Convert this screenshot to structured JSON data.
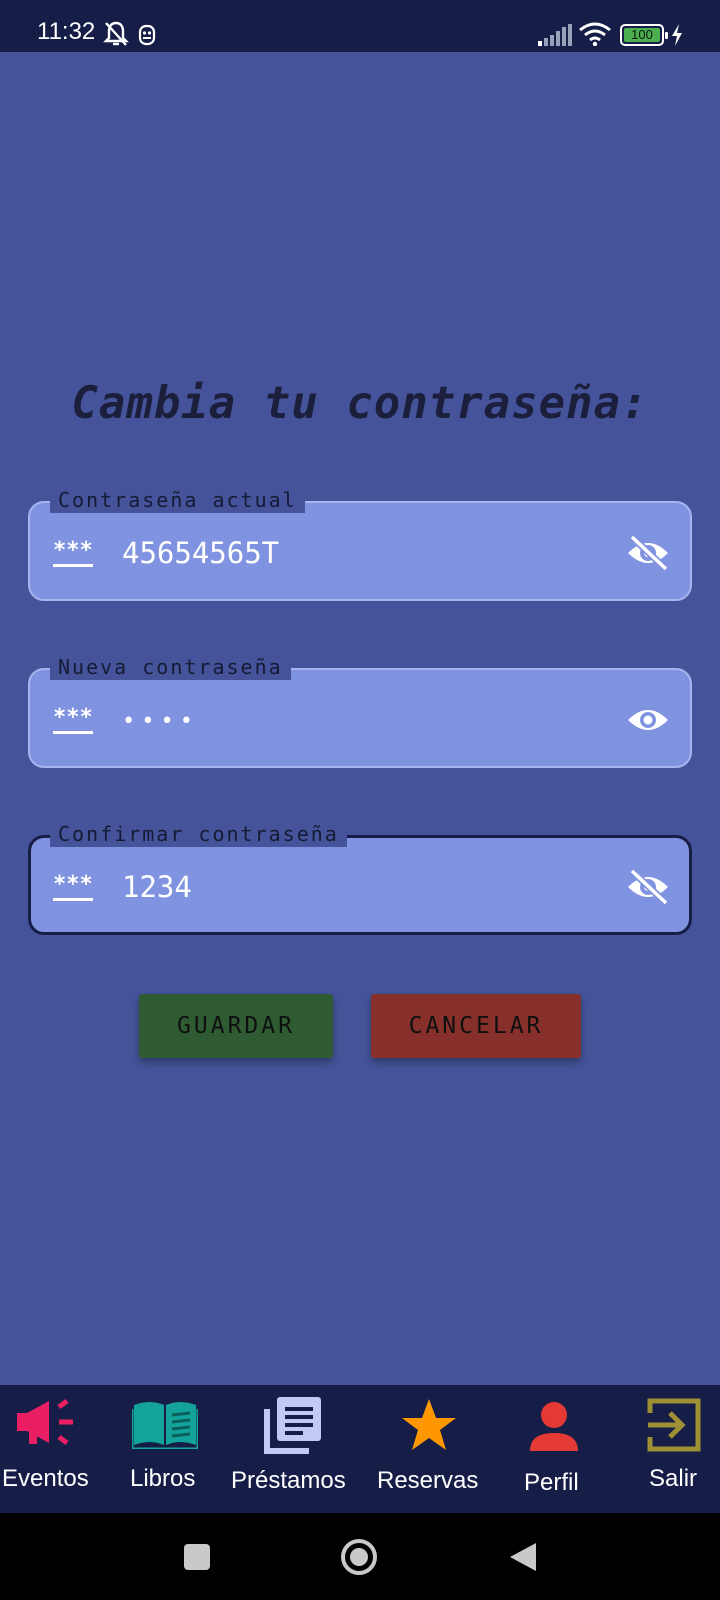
{
  "status_bar": {
    "time": "11:32",
    "battery": "100",
    "icons": [
      "bell-off-icon",
      "mask-icon",
      "signal-icon",
      "wifi-icon",
      "battery-icon",
      "charging-icon"
    ]
  },
  "page": {
    "title": "Cambia tu contraseña:",
    "background": "#45549a"
  },
  "form": {
    "current_password": {
      "label": "Contraseña actual",
      "value": "45654565T",
      "visibility_icon": "eye-off-icon"
    },
    "new_password": {
      "label": "Nueva contraseña",
      "masked_value": "••••",
      "visibility_icon": "eye-icon"
    },
    "confirm_password": {
      "label": "Confirmar contraseña",
      "value": "1234",
      "visibility_icon": "eye-off-icon"
    }
  },
  "buttons": {
    "save": {
      "label": "GUARDAR",
      "color": "#2f5b33"
    },
    "cancel": {
      "label": "CANCELAR",
      "color": "#87302b"
    }
  },
  "bottom_nav": {
    "items": [
      {
        "label": "Eventos",
        "icon": "megaphone-icon",
        "color": "#e91e63"
      },
      {
        "label": "Libros",
        "icon": "book-icon",
        "color": "#14a39a"
      },
      {
        "label": "Préstamos",
        "icon": "library-icon",
        "color": "#c3c9f5"
      },
      {
        "label": "Reservas",
        "icon": "star-icon",
        "color": "#ff9800"
      },
      {
        "label": "Perfil",
        "icon": "person-icon",
        "color": "#e53935"
      },
      {
        "label": "Salir",
        "icon": "exit-icon",
        "color": "#a09035"
      }
    ]
  },
  "system_nav": {
    "icons": [
      "recents-icon",
      "home-icon",
      "back-icon"
    ]
  }
}
